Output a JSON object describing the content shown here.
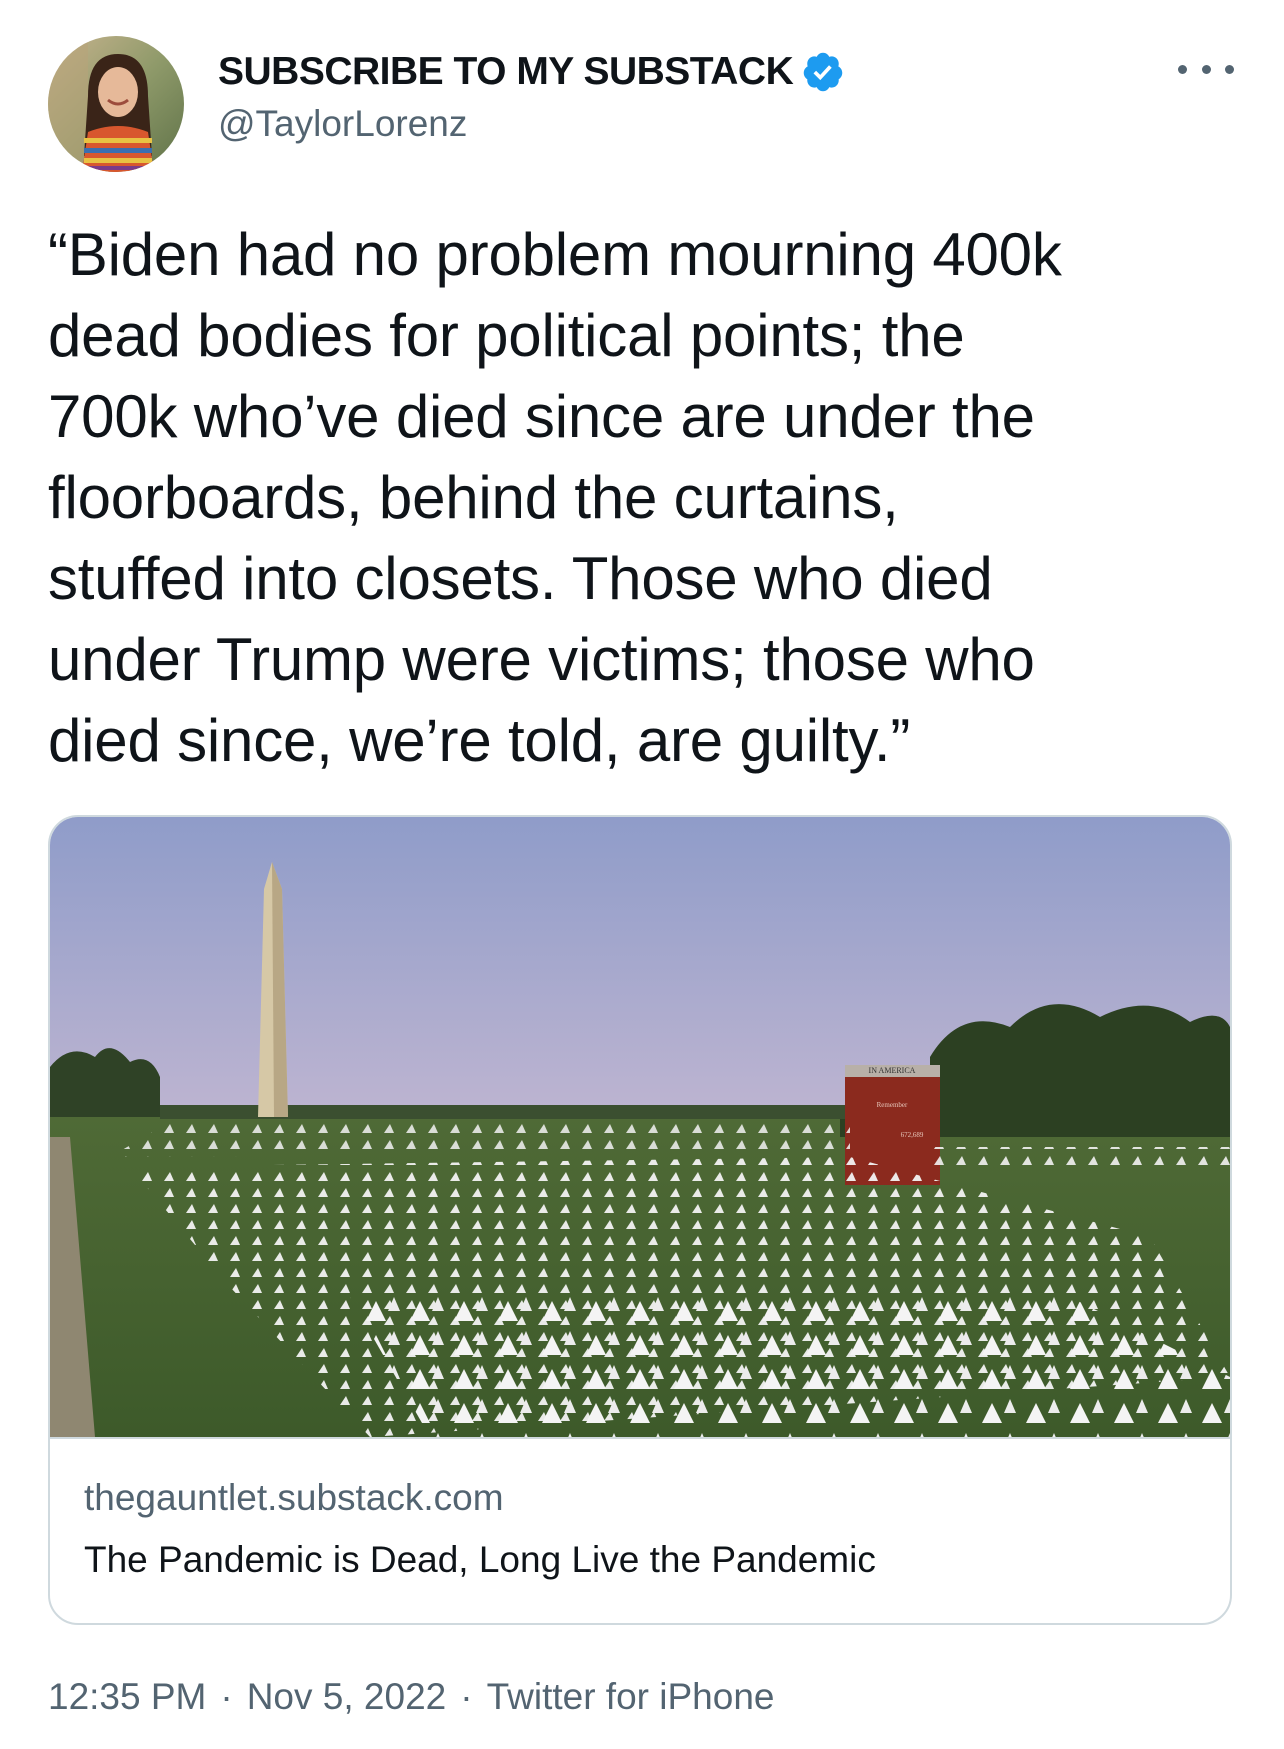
{
  "author": {
    "display_name": "SUBSCRIBE TO MY SUBSTACK",
    "handle": "@TaylorLorenz",
    "verified": true,
    "avatar_icon": "profile-photo"
  },
  "more_icon": "more-horizontal-icon",
  "tweet": {
    "text": "“Biden had no problem mourning 400k\ndead bodies for political points; the\n700k who’ve died since are under the\nfloorboards, behind the curtains,\nstuffed into closets. Those who died\nunder Trump were victims; those who\ndied since, we’re told, are guilty.”"
  },
  "card": {
    "image_sign": {
      "line1": "IN AMERICA",
      "line2": "Remember",
      "line3": "672,689"
    },
    "domain": "thegauntlet.substack.com",
    "title": "The Pandemic is Dead, Long Live the Pandemic"
  },
  "meta": {
    "time": "12:35 PM",
    "separator": "·",
    "date": "Nov 5, 2022",
    "source": "Twitter for iPhone"
  },
  "colors": {
    "text": "#0f1419",
    "secondary": "#536471",
    "verified": "#1d9bf0",
    "border": "#cfd9de"
  }
}
